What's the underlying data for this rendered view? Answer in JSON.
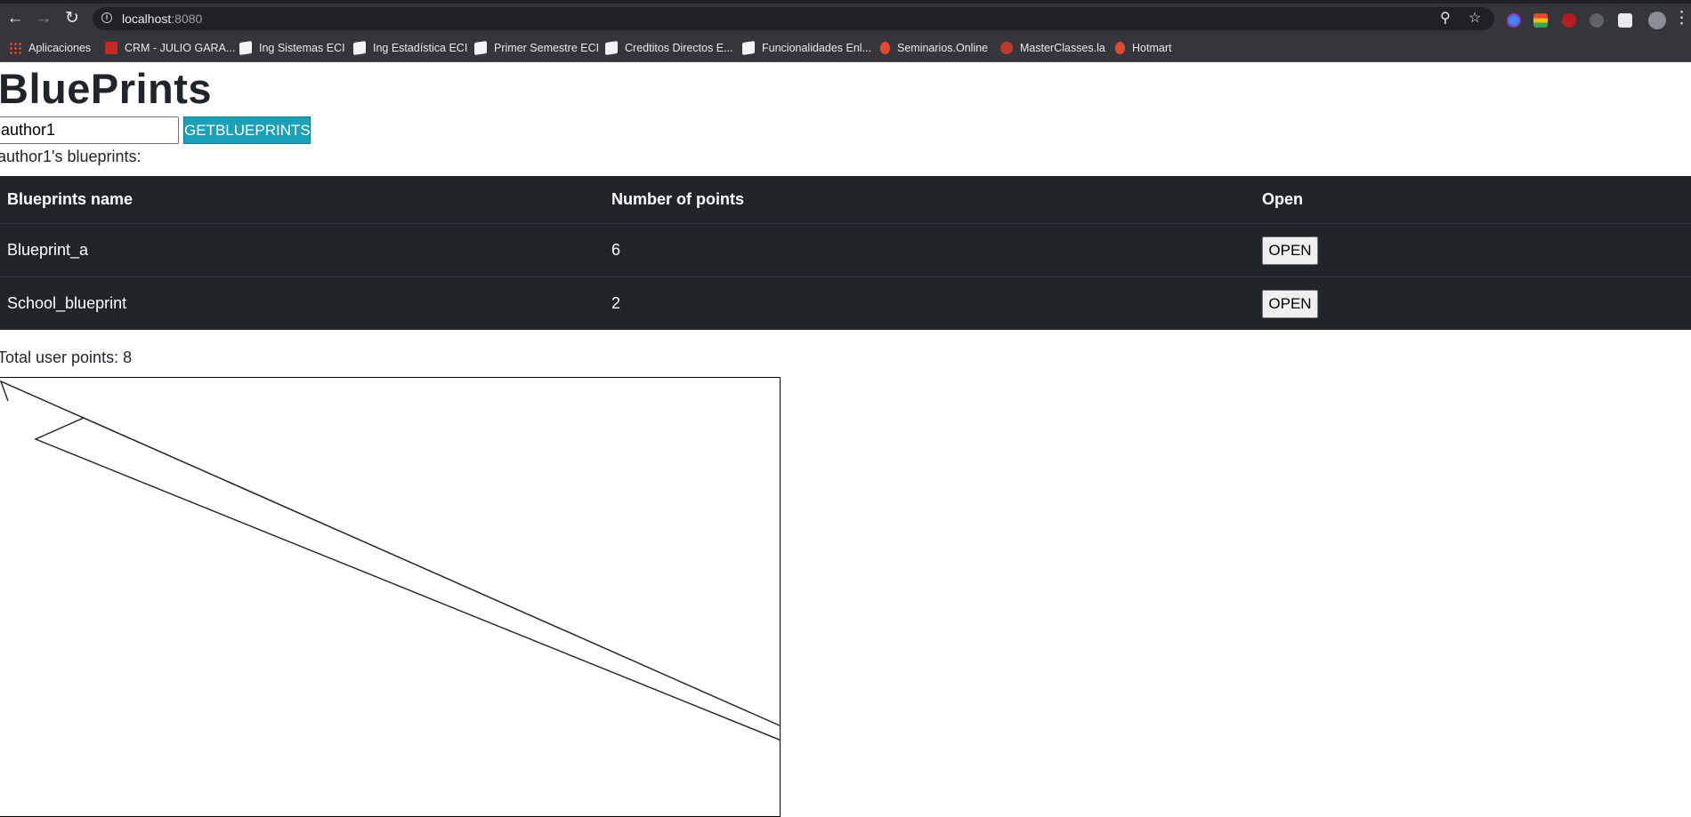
{
  "browser": {
    "url_host": "localhost",
    "url_port": ":8080",
    "bookmarks": [
      {
        "label": "Aplicaciones",
        "icon": "apps-grid-icon"
      },
      {
        "label": "CRM - JULIO GARA...",
        "icon": "crm-icon"
      },
      {
        "label": "Ing Sistemas ECI",
        "icon": "page-icon"
      },
      {
        "label": "Ing Estadística ECI",
        "icon": "page-icon"
      },
      {
        "label": "Primer Semestre ECI",
        "icon": "page-icon"
      },
      {
        "label": "Credtitos Directos E...",
        "icon": "page-icon"
      },
      {
        "label": "Funcionalidades Enl...",
        "icon": "page-icon"
      },
      {
        "label": "Seminarios.Online",
        "icon": "fire-icon"
      },
      {
        "label": "MasterClasses.la",
        "icon": "play-icon"
      },
      {
        "label": "Hotmart",
        "icon": "fire-icon"
      }
    ]
  },
  "page": {
    "title": "BluePrints",
    "author_input_value": "author1",
    "get_button_label": "GETBLUEPRINTS",
    "subtitle": "author1's blueprints:",
    "table": {
      "headers": [
        "Blueprints name",
        "Number of points",
        "Open"
      ],
      "rows": [
        {
          "name": "Blueprint_a",
          "points": "6",
          "action": "OPEN"
        },
        {
          "name": "School_blueprint",
          "points": "2",
          "action": "OPEN"
        }
      ]
    },
    "total_label": "Total user points: 8"
  },
  "colors": {
    "accent_button": "#17a2b8",
    "table_background": "#212529",
    "chrome_background": "#35363a"
  }
}
